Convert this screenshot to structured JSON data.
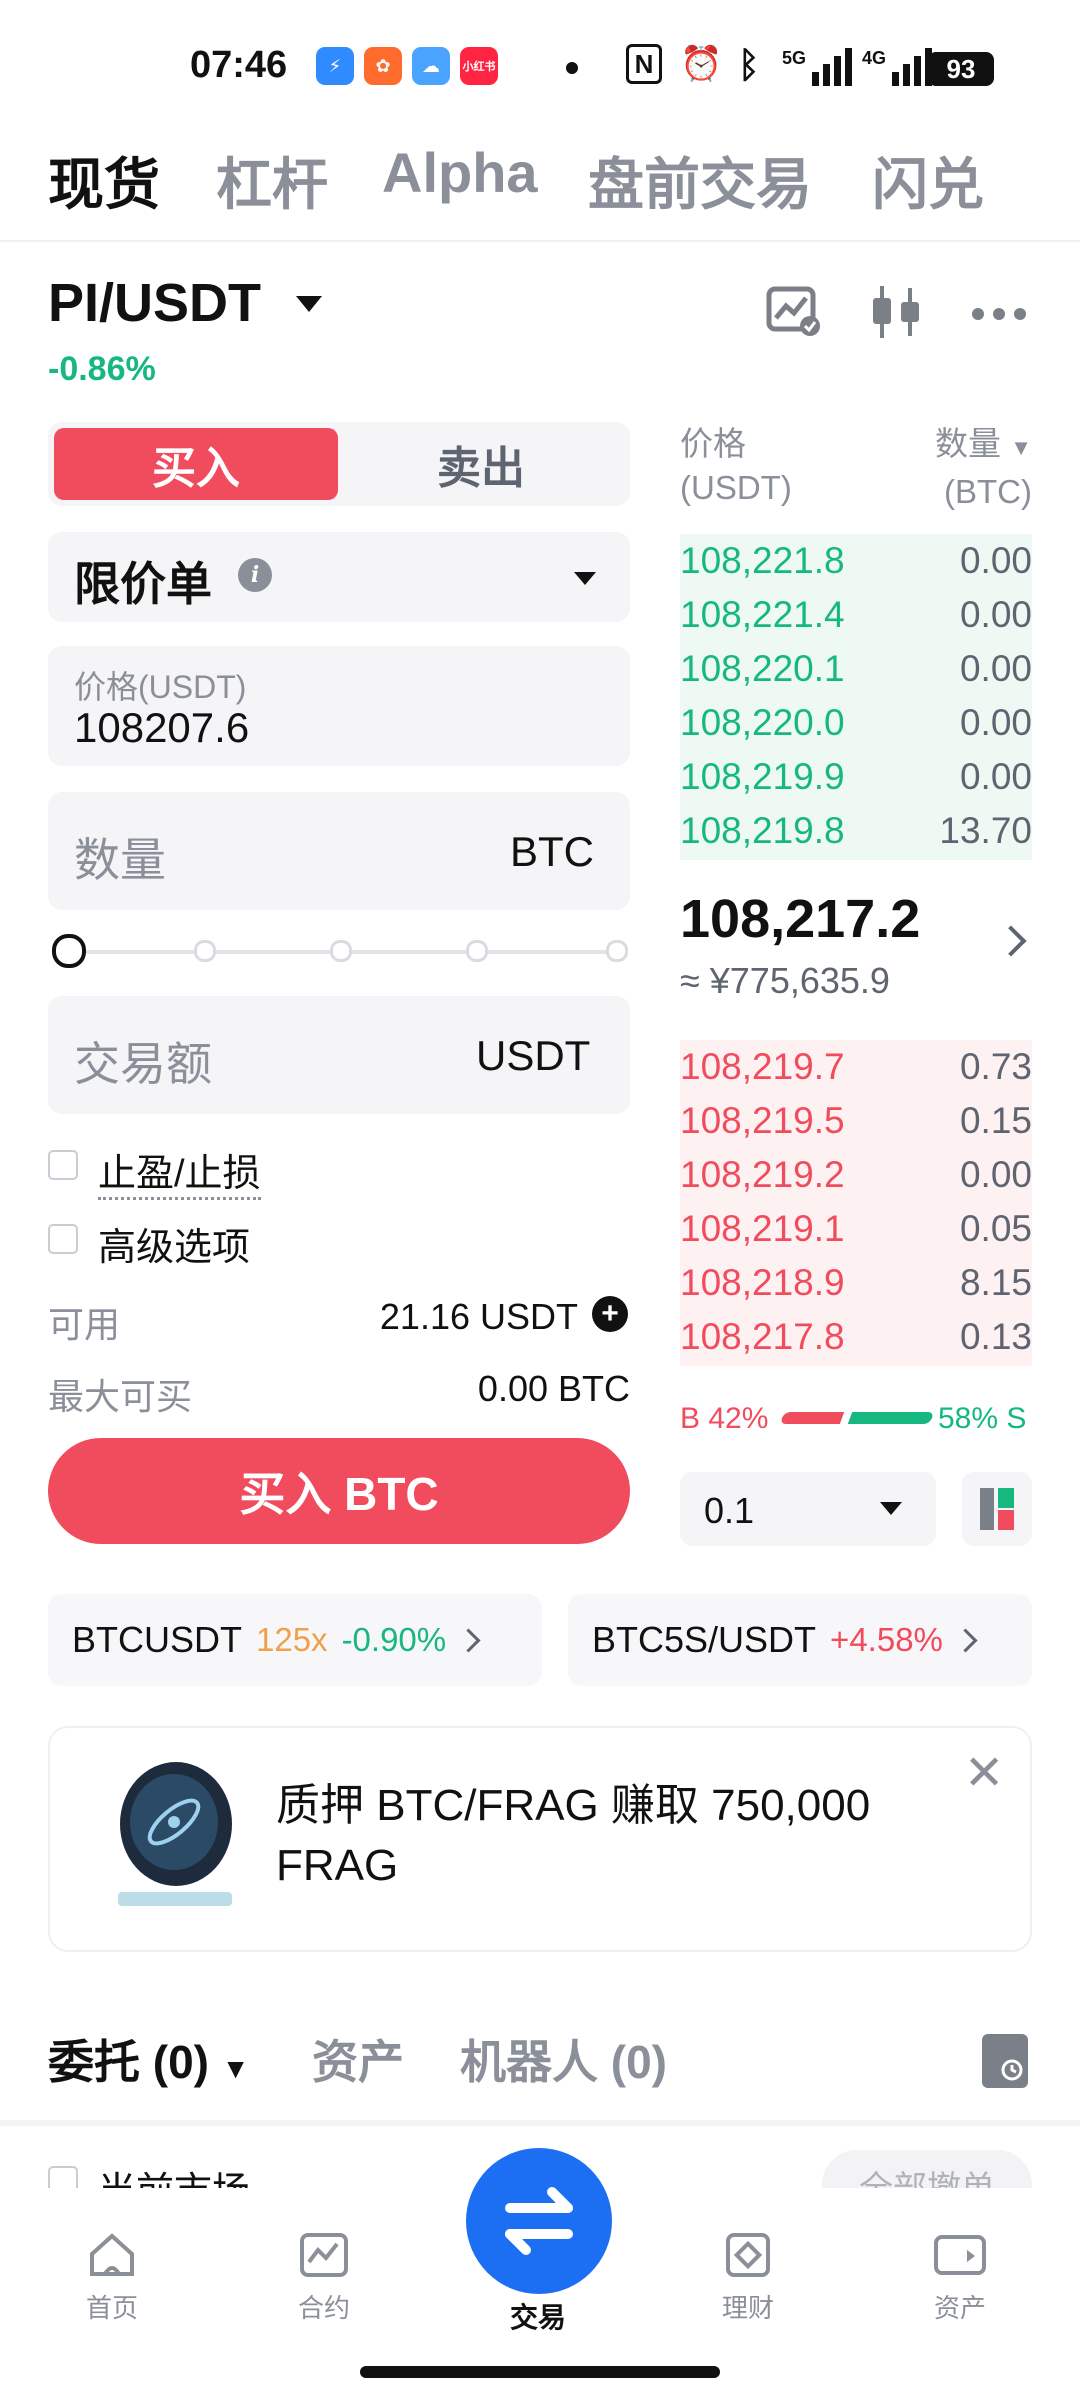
{
  "status": {
    "time": "07:46",
    "apps": [
      {
        "name": "flash-app-icon",
        "glyph": "⚡",
        "color": "#2f8bff"
      },
      {
        "name": "grid-app-icon",
        "glyph": "✿",
        "color": "#ff6b2c"
      },
      {
        "name": "weather-app-icon",
        "glyph": "☁",
        "color": "#4aa3ff"
      },
      {
        "name": "xiaohongshu-app-icon",
        "glyph": "小红书",
        "color": "#ff2442"
      }
    ],
    "nfc": "N",
    "alarm": "⏰",
    "bluetooth": "ᛒ",
    "net1": "5G",
    "net2": "4G",
    "battery": "93"
  },
  "top_tabs": [
    "现货",
    "杠杆",
    "Alpha",
    "盘前交易",
    "闪兑"
  ],
  "pair": {
    "symbol": "PI/USDT",
    "change": "-0.86%"
  },
  "form": {
    "buy_label": "买入",
    "sell_label": "卖出",
    "order_type": "限价单",
    "info_icon": "i",
    "price_label": "价格(USDT)",
    "price_value": "108207.6",
    "qty_placeholder": "数量",
    "qty_unit": "BTC",
    "slider_percent": 0,
    "amount_placeholder": "交易额",
    "amount_unit": "USDT",
    "tpsl_label": "止盈/止损",
    "advanced_label": "高级选项",
    "available_label": "可用",
    "available_value": "21.16 USDT",
    "max_buy_label": "最大可买",
    "max_buy_value": "0.00 BTC",
    "submit_label": "买入 BTC"
  },
  "orderbook": {
    "price_header": "价格",
    "price_unit": "(USDT)",
    "qty_header": "数量",
    "qty_unit": "(BTC)",
    "asks": [
      {
        "price": "108,221.8",
        "qty": "0.00"
      },
      {
        "price": "108,221.4",
        "qty": "0.00"
      },
      {
        "price": "108,220.1",
        "qty": "0.00"
      },
      {
        "price": "108,220.0",
        "qty": "0.00"
      },
      {
        "price": "108,219.9",
        "qty": "0.00"
      },
      {
        "price": "108,219.8",
        "qty": "13.70"
      }
    ],
    "last_price": "108,217.2",
    "cny_price": "≈ ¥775,635.9",
    "bids": [
      {
        "price": "108,219.7",
        "qty": "0.73"
      },
      {
        "price": "108,219.5",
        "qty": "0.15"
      },
      {
        "price": "108,219.2",
        "qty": "0.00"
      },
      {
        "price": "108,219.1",
        "qty": "0.05"
      },
      {
        "price": "108,218.9",
        "qty": "8.15"
      },
      {
        "price": "108,217.8",
        "qty": "0.13"
      }
    ],
    "buy_ratio_label": "B 42%",
    "sell_ratio_label": "58% S",
    "buy_ratio": 0.42,
    "depth": "0.1"
  },
  "tickers": [
    {
      "symbol": "BTCUSDT",
      "leverage": "125x",
      "change": "-0.90%"
    },
    {
      "symbol": "BTC5S/USDT",
      "change": "+4.58%"
    }
  ],
  "promo": {
    "text": "质押 BTC/FRAG 赚取 750,000 FRAG"
  },
  "bottom_tabs": [
    "委托 (0)",
    "资产",
    "机器人 (0)"
  ],
  "orders": {
    "current_market": "当前市场",
    "cancel_all": "全部撤单"
  },
  "nav": {
    "home": "首页",
    "futures": "合约",
    "trade": "交易",
    "earn": "理财",
    "assets": "资产"
  },
  "colors": {
    "up": "#16b880",
    "down": "#f14c5e",
    "accent": "#1c6ff2"
  }
}
